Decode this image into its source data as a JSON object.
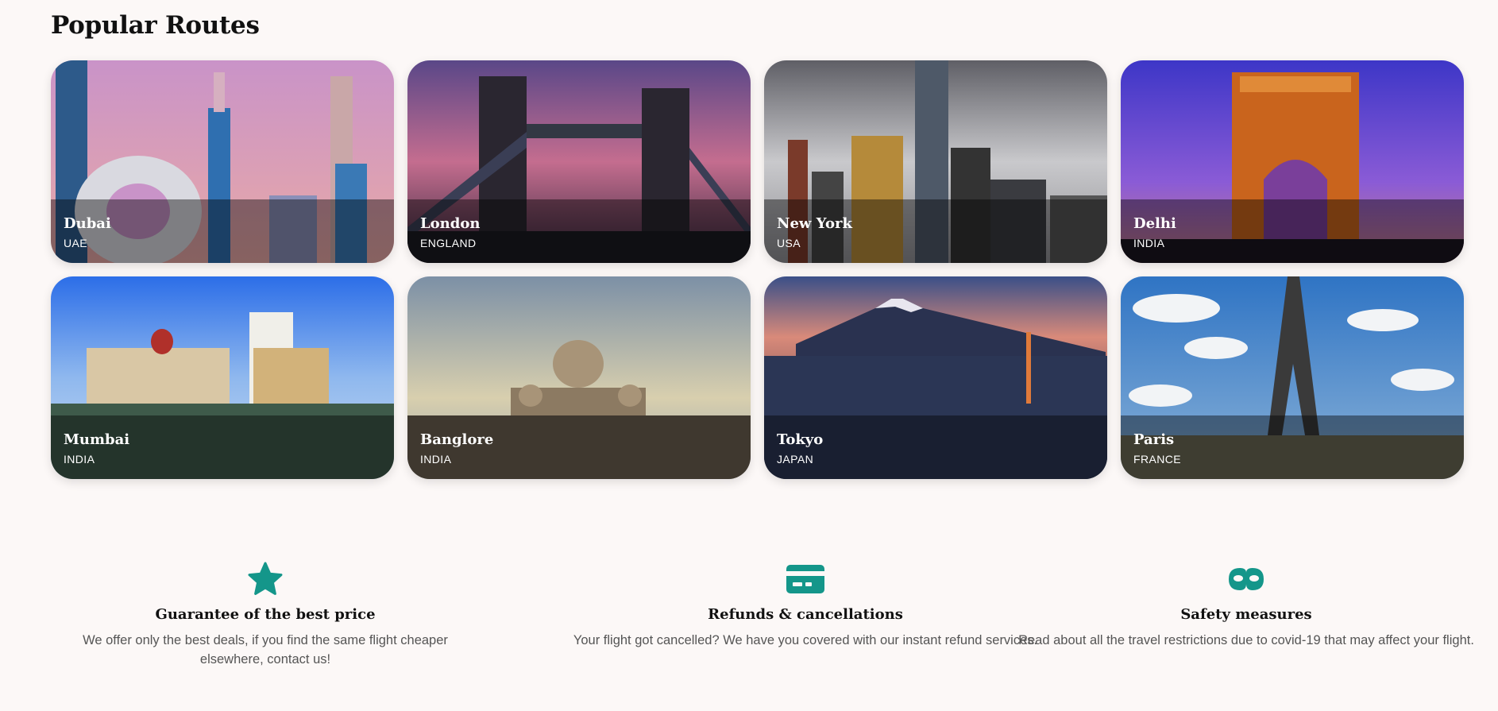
{
  "section": {
    "title": "Popular Routes"
  },
  "routes": [
    {
      "city": "Dubai",
      "country": "UAE"
    },
    {
      "city": "London",
      "country": "ENGLAND"
    },
    {
      "city": "New York",
      "country": "USA"
    },
    {
      "city": "Delhi",
      "country": "INDIA"
    },
    {
      "city": "Mumbai",
      "country": "INDIA"
    },
    {
      "city": "Banglore",
      "country": "INDIA"
    },
    {
      "city": "Tokyo",
      "country": "JAPAN"
    },
    {
      "city": "Paris",
      "country": "FRANCE"
    }
  ],
  "features": [
    {
      "icon": "star-icon",
      "title": "Guarantee of the best price",
      "text": "We offer only the best deals, if you find the same flight cheaper elsewhere, contact us!"
    },
    {
      "icon": "credit-card-icon",
      "title": "Refunds & cancellations",
      "text": "Your flight got cancelled? We have you covered with our instant refund services."
    },
    {
      "icon": "mask-icon",
      "title": "Safety measures",
      "text": "Read about all the travel restrictions due to covid-19 that may affect your flight."
    }
  ],
  "colors": {
    "accent": "#14968a",
    "background": "#fcf8f7"
  }
}
